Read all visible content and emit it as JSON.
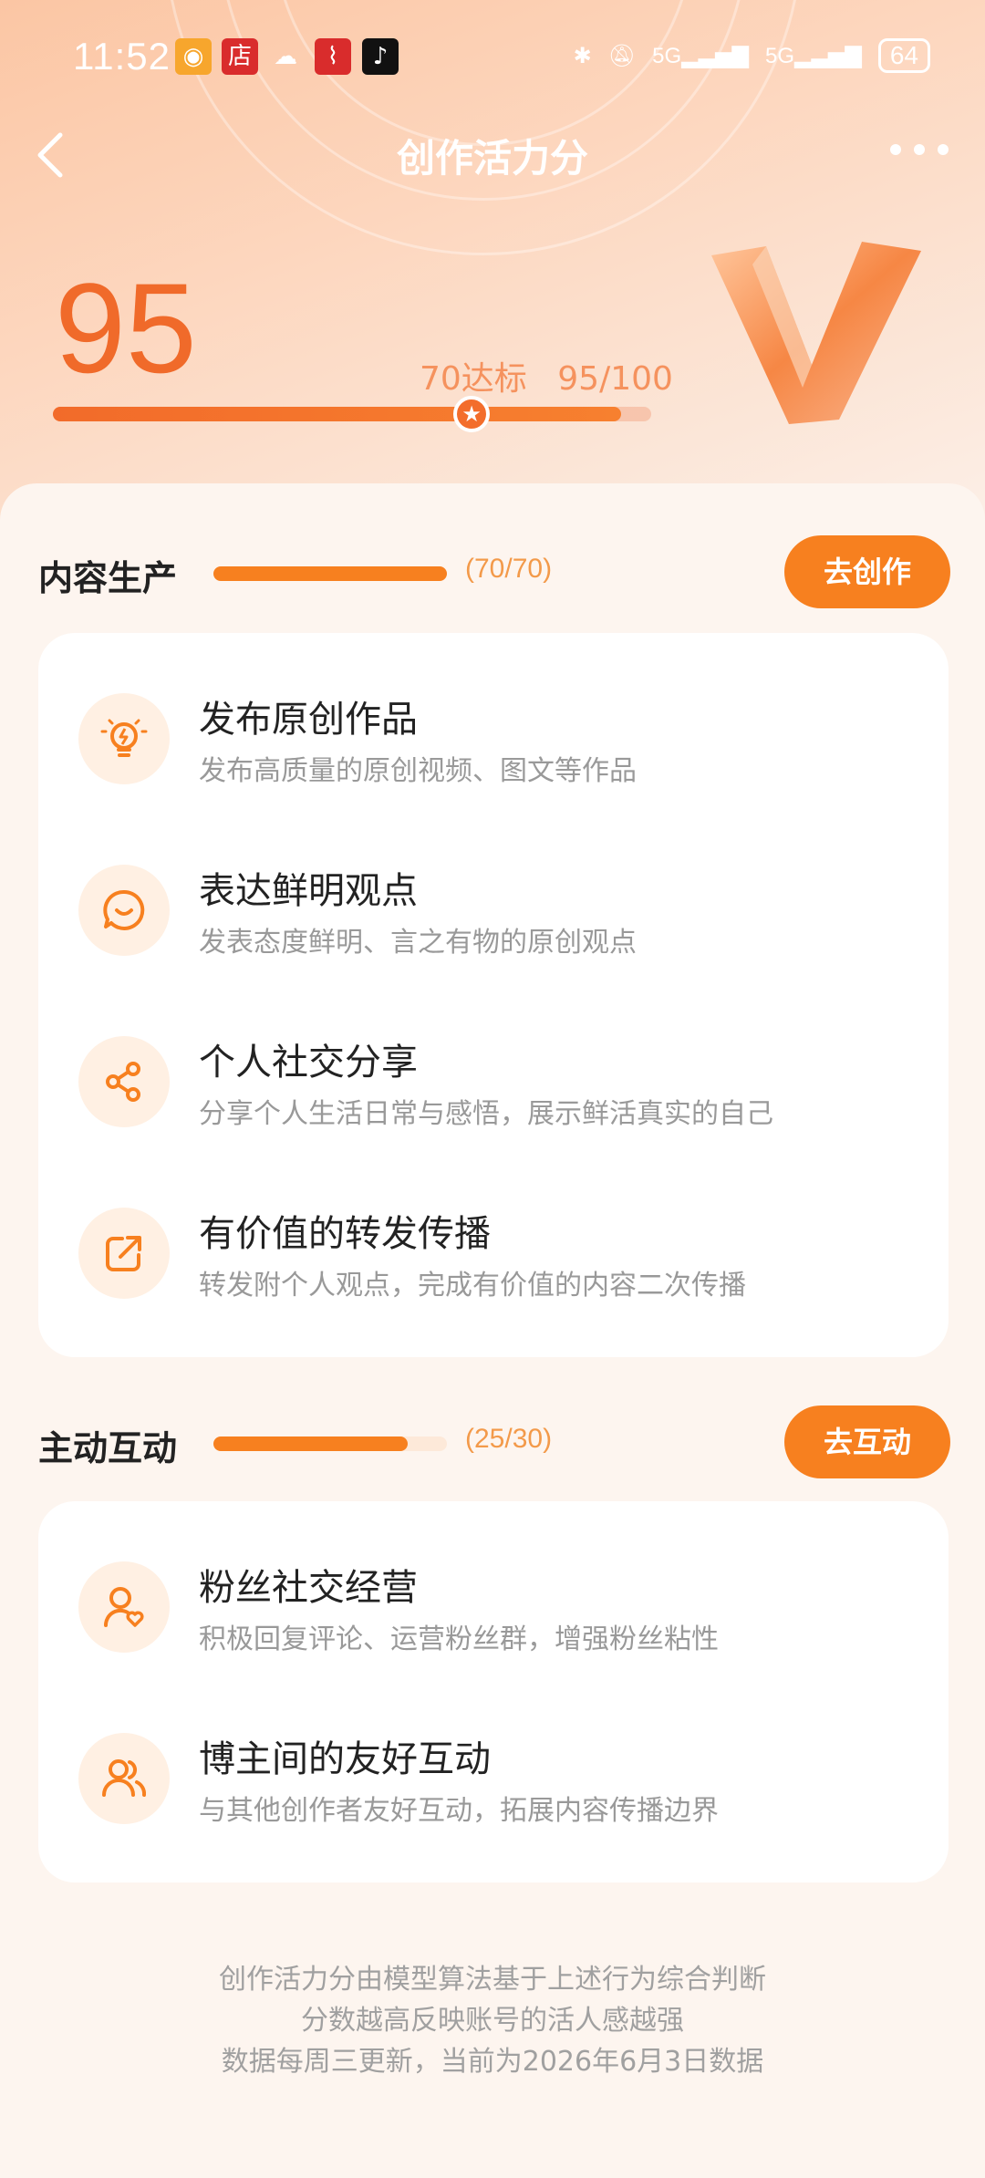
{
  "status_bar": {
    "time": "11:52",
    "app_icons": [
      "weibo-icon",
      "store-icon",
      "wechat-icon",
      "xuexi-icon",
      "tiktok-icon"
    ],
    "signal1": "5G",
    "signal2": "5G",
    "battery": "64"
  },
  "nav": {
    "title": "创作活力分",
    "back_icon": "chevron-left-icon",
    "more_icon": "more-dots-icon"
  },
  "score": {
    "value": "95",
    "threshold_label": "70达标",
    "progress_label": "95/100",
    "progress_fraction": 0.95,
    "threshold_fraction": 0.7
  },
  "sections": [
    {
      "title": "内容生产",
      "count": "(70/70)",
      "fraction": 1.0,
      "button": "去创作",
      "items": [
        {
          "icon": "lightbulb-icon",
          "title": "发布原创作品",
          "desc": "发布高质量的原创视频、图文等作品"
        },
        {
          "icon": "chat-smile-icon",
          "title": "表达鲜明观点",
          "desc": "发表态度鲜明、言之有物的原创观点"
        },
        {
          "icon": "share-icon",
          "title": "个人社交分享",
          "desc": "分享个人生活日常与感悟，展示鲜活真实的自己"
        },
        {
          "icon": "forward-icon",
          "title": "有价值的转发传播",
          "desc": "转发附个人观点，完成有价值的内容二次传播"
        }
      ]
    },
    {
      "title": "主动互动",
      "count": "(25/30)",
      "fraction": 0.8333,
      "button": "去互动",
      "items": [
        {
          "icon": "user-heart-icon",
          "title": "粉丝社交经营",
          "desc": "积极回复评论、运营粉丝群，增强粉丝粘性"
        },
        {
          "icon": "users-icon",
          "title": "博主间的友好互动",
          "desc": "与其他创作者友好互动，拓展内容传播边界"
        }
      ]
    }
  ],
  "footer": {
    "line1": "创作活力分由模型算法基于上述行为综合判断",
    "line2": "分数越高反映账号的活人感越强",
    "line3": "数据每周三更新，当前为2026年6月3日数据"
  },
  "colors": {
    "accent": "#f7801f",
    "score": "#f06a2a",
    "icon_bg": "#fff0e3"
  }
}
